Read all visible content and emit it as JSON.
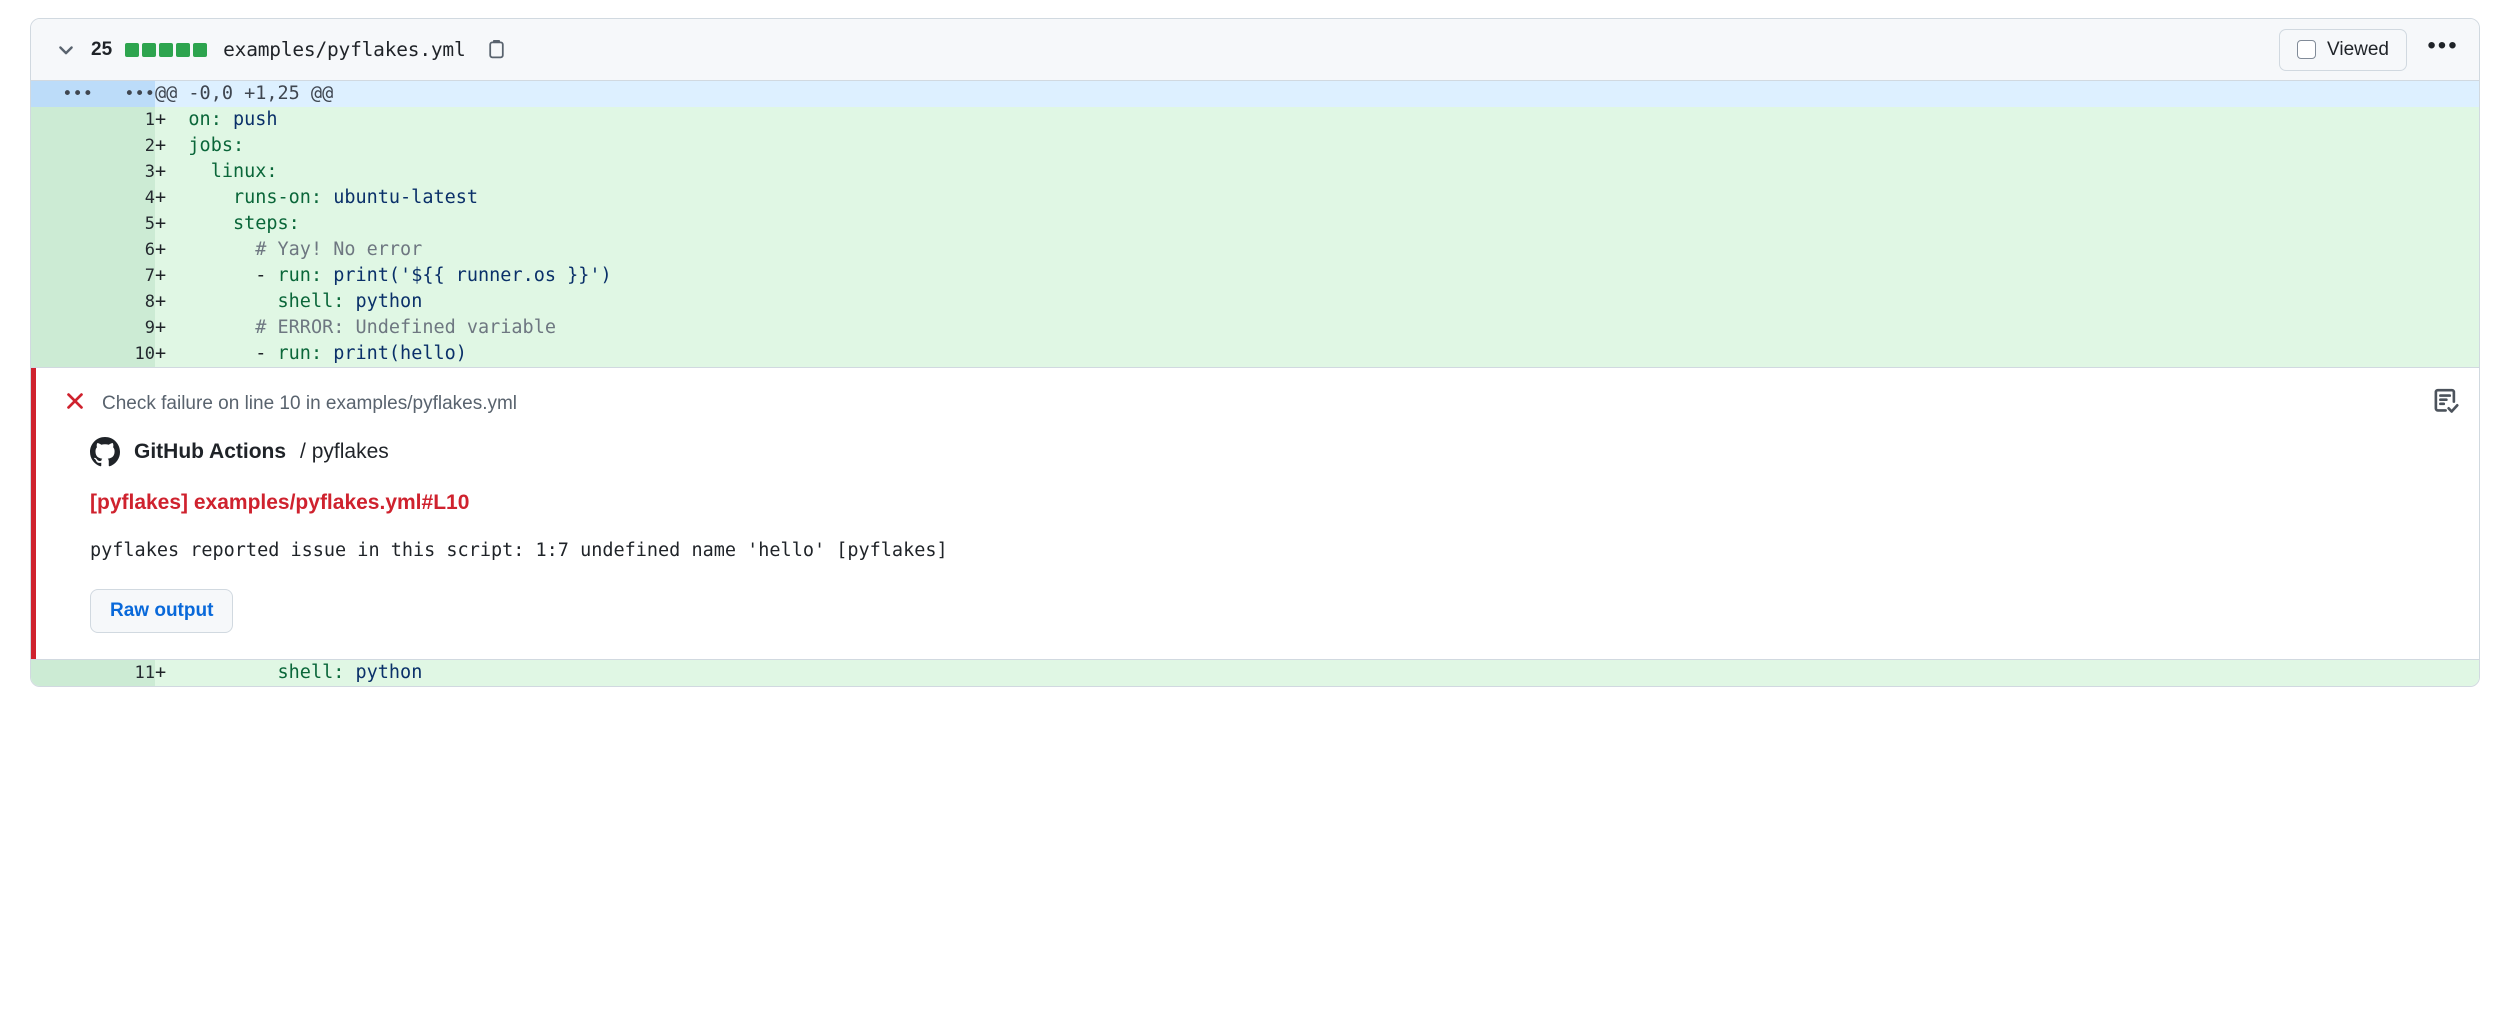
{
  "file_header": {
    "chevron_icon": "chevron-down-icon",
    "diff_count": "25",
    "diffstat_squares": [
      "#2da44e",
      "#2da44e",
      "#2da44e",
      "#2da44e",
      "#2da44e"
    ],
    "file_path": "examples/pyflakes.yml",
    "copy_icon": "copy-path-icon",
    "viewed_label": "Viewed",
    "viewed_checked": false,
    "kebab_label": "•••"
  },
  "hunk": {
    "left_marker": "•••",
    "right_marker": "•••",
    "header": "@@ -0,0 +1,25 @@"
  },
  "lines": [
    {
      "num": "1",
      "marker": "+",
      "tokens": [
        {
          "t": "plain",
          "s": "  "
        },
        {
          "t": "key",
          "s": "on:"
        },
        {
          "t": "plain",
          "s": " "
        },
        {
          "t": "val",
          "s": "push"
        }
      ]
    },
    {
      "num": "2",
      "marker": "+",
      "tokens": [
        {
          "t": "plain",
          "s": "  "
        },
        {
          "t": "key",
          "s": "jobs:"
        }
      ]
    },
    {
      "num": "3",
      "marker": "+",
      "tokens": [
        {
          "t": "plain",
          "s": "    "
        },
        {
          "t": "key",
          "s": "linux:"
        }
      ]
    },
    {
      "num": "4",
      "marker": "+",
      "tokens": [
        {
          "t": "plain",
          "s": "      "
        },
        {
          "t": "key",
          "s": "runs-on:"
        },
        {
          "t": "plain",
          "s": " "
        },
        {
          "t": "val",
          "s": "ubuntu-latest"
        }
      ]
    },
    {
      "num": "5",
      "marker": "+",
      "tokens": [
        {
          "t": "plain",
          "s": "      "
        },
        {
          "t": "key",
          "s": "steps:"
        }
      ]
    },
    {
      "num": "6",
      "marker": "+",
      "tokens": [
        {
          "t": "plain",
          "s": "        "
        },
        {
          "t": "com",
          "s": "# Yay! No error"
        }
      ]
    },
    {
      "num": "7",
      "marker": "+",
      "tokens": [
        {
          "t": "plain",
          "s": "        - "
        },
        {
          "t": "key",
          "s": "run:"
        },
        {
          "t": "plain",
          "s": " "
        },
        {
          "t": "val",
          "s": "print('${{ runner.os }}')"
        }
      ]
    },
    {
      "num": "8",
      "marker": "+",
      "tokens": [
        {
          "t": "plain",
          "s": "          "
        },
        {
          "t": "key",
          "s": "shell:"
        },
        {
          "t": "plain",
          "s": " "
        },
        {
          "t": "val",
          "s": "python"
        }
      ]
    },
    {
      "num": "9",
      "marker": "+",
      "tokens": [
        {
          "t": "plain",
          "s": "        "
        },
        {
          "t": "com",
          "s": "# ERROR: Undefined variable"
        }
      ]
    },
    {
      "num": "10",
      "marker": "+",
      "tokens": [
        {
          "t": "plain",
          "s": "        - "
        },
        {
          "t": "key",
          "s": "run:"
        },
        {
          "t": "plain",
          "s": " "
        },
        {
          "t": "val",
          "s": "print(hello)"
        }
      ]
    }
  ],
  "lines_after": [
    {
      "num": "11",
      "marker": "+",
      "tokens": [
        {
          "t": "plain",
          "s": "          "
        },
        {
          "t": "key",
          "s": "shell:"
        },
        {
          "t": "plain",
          "s": " "
        },
        {
          "t": "val",
          "s": "python"
        }
      ]
    }
  ],
  "annotation": {
    "status_icon": "x-failure-icon",
    "status_icon_color": "#cf222e",
    "heading": "Check failure on line 10 in examples/pyflakes.yml",
    "app_icon": "github-mark-icon",
    "app_name": "GitHub Actions",
    "app_check": "/ pyflakes",
    "title": "[pyflakes] examples/pyflakes.yml#L10",
    "message": "pyflakes reported issue in this script: 1:7 undefined name 'hello' [pyflakes]",
    "raw_output_label": "Raw output",
    "report_icon": "checklist-report-icon",
    "accent_color": "#cf222e"
  }
}
